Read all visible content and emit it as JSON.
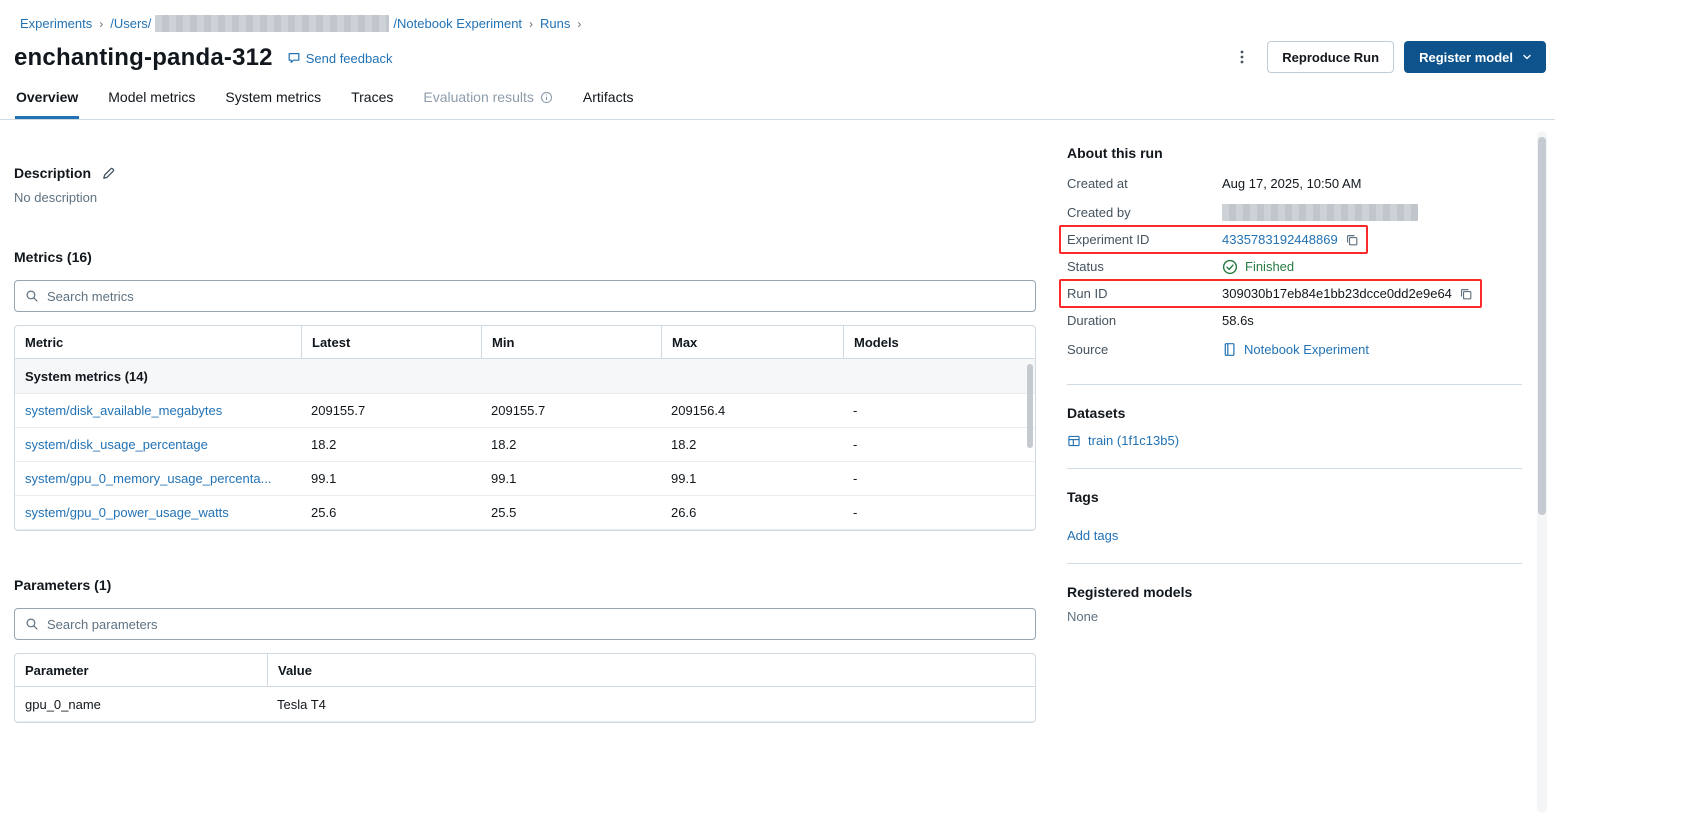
{
  "breadcrumb": {
    "experiments": "Experiments",
    "users_prefix": "/Users/",
    "experiment_suffix": "/Notebook Experiment",
    "runs": "Runs",
    "separator": "›"
  },
  "header": {
    "title": "enchanting-panda-312",
    "send_feedback": "Send feedback",
    "reproduce_run": "Reproduce Run",
    "register_model": "Register model"
  },
  "tabs": {
    "overview": "Overview",
    "model_metrics": "Model metrics",
    "system_metrics": "System metrics",
    "traces": "Traces",
    "evaluation_results": "Evaluation results",
    "artifacts": "Artifacts"
  },
  "description": {
    "title": "Description",
    "empty": "No description"
  },
  "metrics": {
    "title": "Metrics (16)",
    "search_placeholder": "Search metrics",
    "columns": {
      "metric": "Metric",
      "latest": "Latest",
      "min": "Min",
      "max": "Max",
      "models": "Models"
    },
    "group_header": "System metrics (14)",
    "rows": [
      {
        "metric": "system/disk_available_megabytes",
        "latest": "209155.7",
        "min": "209155.7",
        "max": "209156.4",
        "models": "-"
      },
      {
        "metric": "system/disk_usage_percentage",
        "latest": "18.2",
        "min": "18.2",
        "max": "18.2",
        "models": "-"
      },
      {
        "metric": "system/gpu_0_memory_usage_percenta...",
        "latest": "99.1",
        "min": "99.1",
        "max": "99.1",
        "models": "-"
      },
      {
        "metric": "system/gpu_0_power_usage_watts",
        "latest": "25.6",
        "min": "25.5",
        "max": "26.6",
        "models": "-"
      }
    ]
  },
  "parameters": {
    "title": "Parameters (1)",
    "search_placeholder": "Search parameters",
    "columns": {
      "parameter": "Parameter",
      "value": "Value"
    },
    "rows": [
      {
        "parameter": "gpu_0_name",
        "value": "Tesla T4"
      }
    ]
  },
  "about": {
    "title": "About this run",
    "created_at_label": "Created at",
    "created_at_value": "Aug 17, 2025, 10:50 AM",
    "created_by_label": "Created by",
    "experiment_id_label": "Experiment ID",
    "experiment_id_value": "4335783192448869",
    "status_label": "Status",
    "status_value": "Finished",
    "run_id_label": "Run ID",
    "run_id_value": "309030b17eb84e1bb23dcce0dd2e9e64",
    "duration_label": "Duration",
    "duration_value": "58.6s",
    "source_label": "Source",
    "source_value": "Notebook Experiment"
  },
  "datasets": {
    "title": "Datasets",
    "train": "train (1f1c13b5)"
  },
  "tags": {
    "title": "Tags",
    "add_tags": "Add tags"
  },
  "registered_models": {
    "title": "Registered models",
    "none": "None"
  },
  "colors": {
    "link": "#2272b4",
    "primary_button": "#0e538b",
    "success_green": "#277c43",
    "annotation_red": "#fb2b2b"
  }
}
